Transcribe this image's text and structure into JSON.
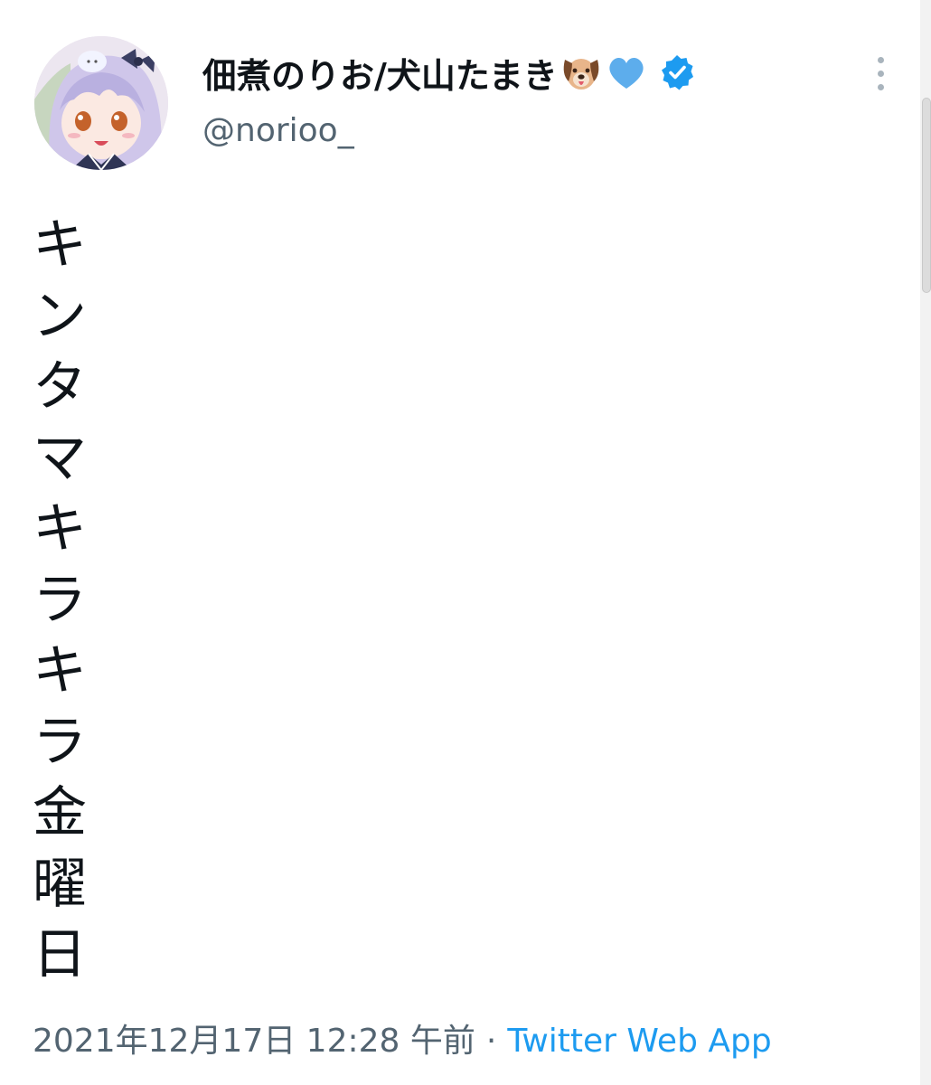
{
  "author": {
    "display_name": "佃煮のりお/犬山たまき",
    "handle": "@norioo_",
    "name_emojis": [
      "dog-face-emoji",
      "blue-heart-emoji"
    ],
    "verified": true,
    "verified_color": "#1d9bf0"
  },
  "tweet": {
    "chars": [
      "キ",
      "ン",
      "タ",
      "マ",
      "キ",
      "ラ",
      "キ",
      "ラ",
      "金",
      "曜",
      "日"
    ]
  },
  "meta": {
    "timestamp": "2021年12月17日 12:28 午前",
    "separator": "·",
    "source": "Twitter Web App"
  },
  "colors": {
    "text": "#0f1419",
    "secondary": "#536471",
    "link": "#1d9bf0"
  }
}
